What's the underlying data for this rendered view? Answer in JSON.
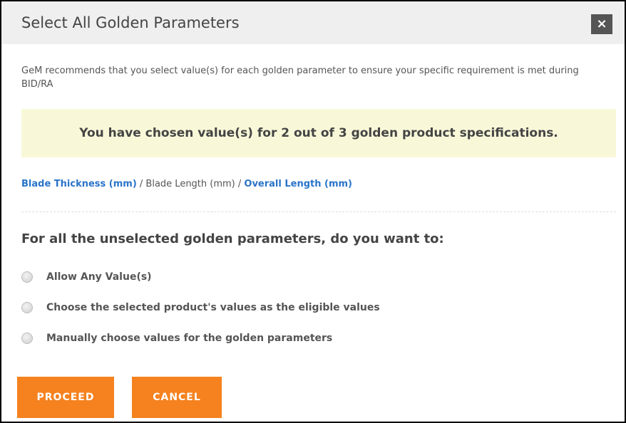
{
  "dialog": {
    "title": "Select All Golden Parameters",
    "close_label": "×"
  },
  "description": "GeM recommends that you select value(s) for each golden parameter to ensure your specific requirement is met during BID/RA",
  "notice": "You have chosen value(s) for 2 out of 3 golden product specifications.",
  "parameters": [
    {
      "label": "Blade Thickness (mm)",
      "selected": true
    },
    {
      "label": "Blade Length (mm)",
      "selected": false
    },
    {
      "label": "Overall Length (mm)",
      "selected": true
    }
  ],
  "separator": " / ",
  "question": "For all the unselected golden parameters, do you want to:",
  "options": [
    {
      "label": "Allow Any Value(s)",
      "checked": false
    },
    {
      "label": "Choose the selected product's values as the eligible values",
      "checked": false
    },
    {
      "label": "Manually choose values for the golden parameters",
      "checked": false
    }
  ],
  "buttons": {
    "proceed": "PROCEED",
    "cancel": "CANCEL"
  },
  "colors": {
    "accent": "#f5821f",
    "link": "#2a74c9",
    "notice_bg": "#f8f8d9",
    "header_bg": "#efefef"
  }
}
